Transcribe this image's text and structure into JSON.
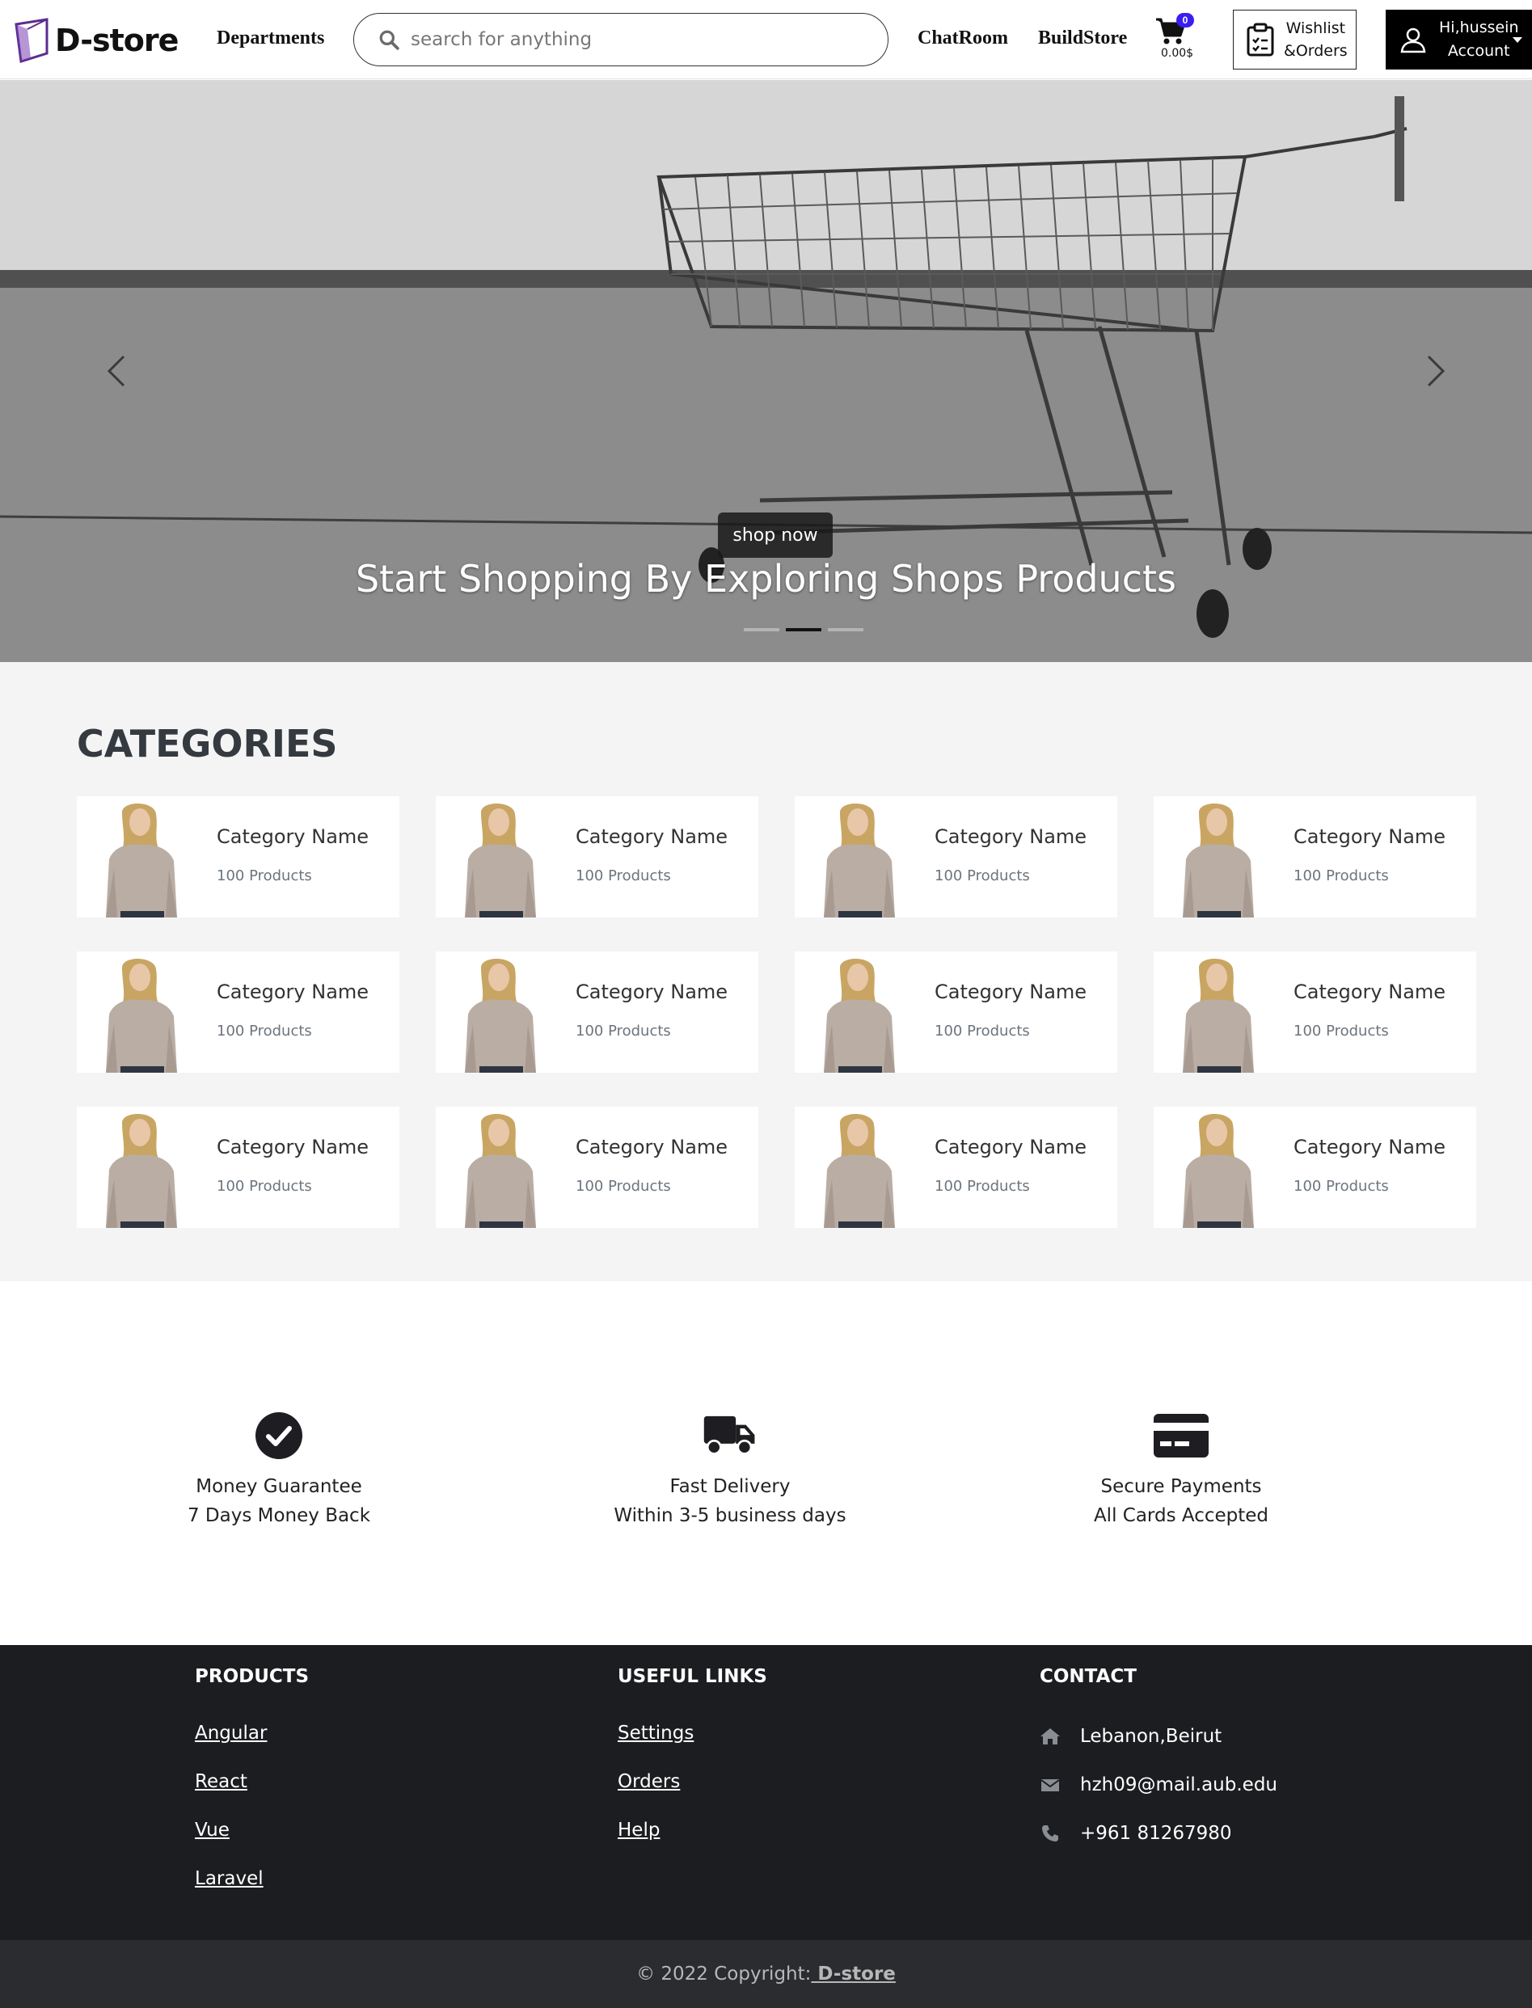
{
  "navbar": {
    "brand": "D-store",
    "links": {
      "departments": "Departments",
      "chatroom": "ChatRoom",
      "buildstore": "BuildStore"
    },
    "search": {
      "placeholder": "search for anything"
    },
    "cart": {
      "count": "0",
      "total": "0.00$"
    },
    "wishlist": {
      "line1": "Wishlist",
      "line2": "&Orders"
    },
    "account": {
      "line1": "Hi,hussein",
      "line2": "Account"
    },
    "icons": [
      "logo-icon",
      "search-icon",
      "cart-icon",
      "clipboard-icon",
      "user-icon",
      "caret-down-icon"
    ]
  },
  "hero": {
    "button": "shop now",
    "title": "Start Shopping By Exploring Shops Products",
    "slides": 3,
    "active_slide": 2
  },
  "categories": {
    "heading": "CATEGORIES",
    "items": [
      {
        "name": "Category Name",
        "count": "100 Products"
      },
      {
        "name": "Category Name",
        "count": "100 Products"
      },
      {
        "name": "Category Name",
        "count": "100 Products"
      },
      {
        "name": "Category Name",
        "count": "100 Products"
      },
      {
        "name": "Category Name",
        "count": "100 Products"
      },
      {
        "name": "Category Name",
        "count": "100 Products"
      },
      {
        "name": "Category Name",
        "count": "100 Products"
      },
      {
        "name": "Category Name",
        "count": "100 Products"
      },
      {
        "name": "Category Name",
        "count": "100 Products"
      },
      {
        "name": "Category Name",
        "count": "100 Products"
      },
      {
        "name": "Category Name",
        "count": "100 Products"
      },
      {
        "name": "Category Name",
        "count": "100 Products"
      }
    ]
  },
  "features": [
    {
      "icon": "check-circle-icon",
      "title": "Money Guarantee",
      "subtitle": "7 Days Money Back"
    },
    {
      "icon": "truck-icon",
      "title": "Fast Delivery",
      "subtitle": "Within 3-5 business days"
    },
    {
      "icon": "credit-card-icon",
      "title": "Secure Payments",
      "subtitle": "All Cards Accepted"
    }
  ],
  "footer": {
    "products": {
      "heading": "PRODUCTS",
      "links": [
        "Angular",
        "React",
        "Vue",
        "Laravel"
      ]
    },
    "useful_links": {
      "heading": "USEFUL LINKS",
      "links": [
        "Settings",
        "Orders",
        "Help"
      ]
    },
    "contact": {
      "heading": "CONTACT",
      "address": "Lebanon,Beirut",
      "email": "hzh09@mail.aub.edu",
      "phone": "+961 81267980"
    },
    "copyright_prefix": "© 2022 Copyright:",
    "copyright_brand": " D-store"
  },
  "colors": {
    "accent": "#3a1ef0",
    "footer_bg": "#1c1d20",
    "copyright_bg": "#2b2c30",
    "section_bg": "#f4f4f4"
  }
}
